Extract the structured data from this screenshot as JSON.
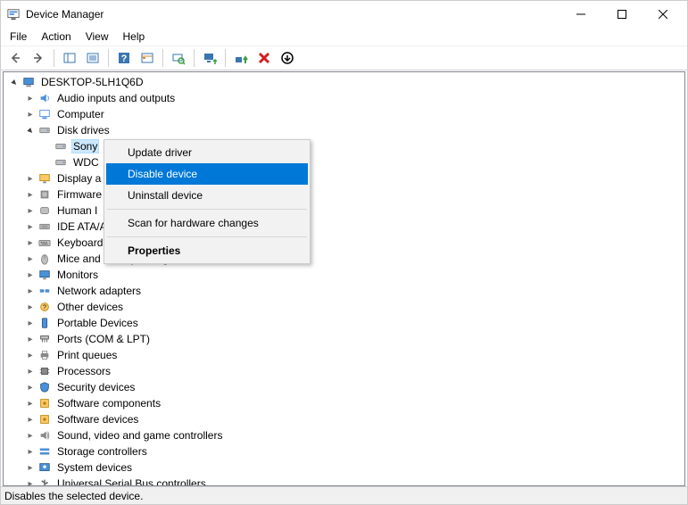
{
  "window": {
    "title": "Device Manager"
  },
  "menubar": [
    "File",
    "Action",
    "View",
    "Help"
  ],
  "statusbar": "Disables the selected device.",
  "contextMenu": {
    "items": [
      {
        "label": "Update driver",
        "type": "item"
      },
      {
        "label": "Disable device",
        "type": "item",
        "highlight": true
      },
      {
        "label": "Uninstall device",
        "type": "item"
      },
      {
        "type": "sep"
      },
      {
        "label": "Scan for hardware changes",
        "type": "item"
      },
      {
        "type": "sep"
      },
      {
        "label": "Properties",
        "type": "item",
        "bold": true
      }
    ]
  },
  "tree": {
    "root": "DESKTOP-5LH1Q6D",
    "nodes": [
      {
        "label": "Audio inputs and outputs",
        "icon": "audio",
        "expandable": true
      },
      {
        "label": "Computer",
        "icon": "computer",
        "expandable": true
      },
      {
        "label": "Disk drives",
        "icon": "disk",
        "expandable": true,
        "expanded": true,
        "children": [
          {
            "label": "Sony",
            "icon": "disk",
            "selected": true
          },
          {
            "label": "WDC",
            "icon": "disk"
          }
        ]
      },
      {
        "label": "Display a",
        "icon": "display",
        "expandable": true,
        "truncated": true
      },
      {
        "label": "Firmware",
        "icon": "firmware",
        "expandable": true,
        "truncated": true
      },
      {
        "label": "Human I",
        "icon": "hid",
        "expandable": true,
        "truncated": true
      },
      {
        "label": "IDE ATA/A",
        "icon": "ide",
        "expandable": true,
        "truncated": true
      },
      {
        "label": "Keyboard",
        "icon": "keyboard",
        "expandable": true,
        "truncated": true
      },
      {
        "label": "Mice and other pointing devices",
        "icon": "mouse",
        "expandable": true
      },
      {
        "label": "Monitors",
        "icon": "monitor",
        "expandable": true
      },
      {
        "label": "Network adapters",
        "icon": "network",
        "expandable": true
      },
      {
        "label": "Other devices",
        "icon": "other",
        "expandable": true
      },
      {
        "label": "Portable Devices",
        "icon": "portable",
        "expandable": true
      },
      {
        "label": "Ports (COM & LPT)",
        "icon": "ports",
        "expandable": true
      },
      {
        "label": "Print queues",
        "icon": "print",
        "expandable": true
      },
      {
        "label": "Processors",
        "icon": "cpu",
        "expandable": true
      },
      {
        "label": "Security devices",
        "icon": "security",
        "expandable": true
      },
      {
        "label": "Software components",
        "icon": "software",
        "expandable": true
      },
      {
        "label": "Software devices",
        "icon": "software",
        "expandable": true
      },
      {
        "label": "Sound, video and game controllers",
        "icon": "sound",
        "expandable": true
      },
      {
        "label": "Storage controllers",
        "icon": "storage",
        "expandable": true
      },
      {
        "label": "System devices",
        "icon": "system",
        "expandable": true
      },
      {
        "label": "Universal Serial Bus controllers",
        "icon": "usb",
        "expandable": true
      }
    ]
  },
  "toolbar": [
    {
      "name": "back",
      "icon": "arrow-left"
    },
    {
      "name": "forward",
      "icon": "arrow-right"
    },
    {
      "type": "sep"
    },
    {
      "name": "show-hide-console-tree",
      "icon": "window-split"
    },
    {
      "name": "properties",
      "icon": "window-lines"
    },
    {
      "type": "sep"
    },
    {
      "name": "help",
      "icon": "help"
    },
    {
      "name": "action-1",
      "icon": "window-grid"
    },
    {
      "type": "sep"
    },
    {
      "name": "scan-hardware",
      "icon": "scan"
    },
    {
      "type": "sep"
    },
    {
      "name": "update-driver",
      "icon": "monitor-up"
    },
    {
      "type": "sep"
    },
    {
      "name": "enable-device",
      "icon": "green-up"
    },
    {
      "name": "uninstall",
      "icon": "red-x"
    },
    {
      "name": "disable-device",
      "icon": "down-circle"
    }
  ]
}
